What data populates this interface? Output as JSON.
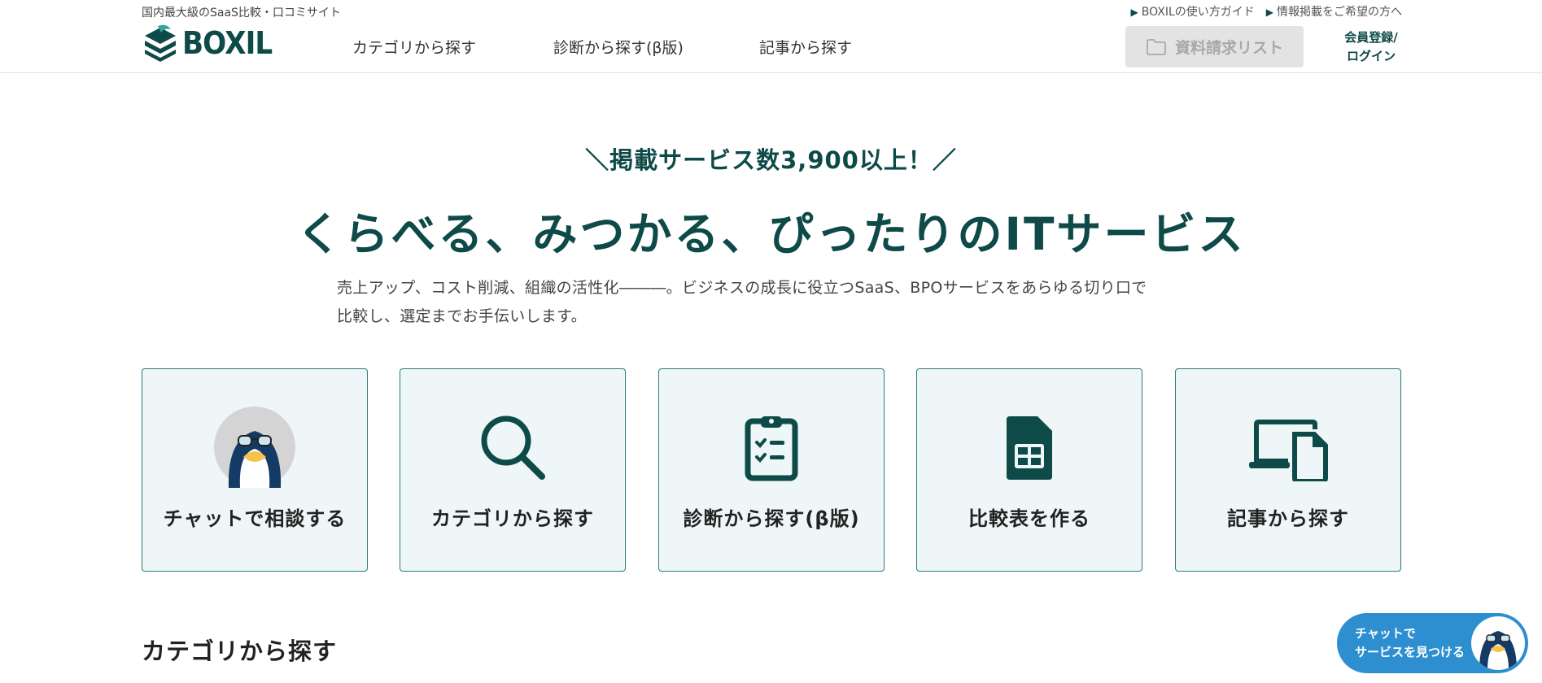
{
  "header": {
    "tagline": "国内最大級のSaaS比較・口コミサイト",
    "logo_text": "BOXIL",
    "nav": [
      "カテゴリから探す",
      "診断から探す(β版)",
      "記事から探す"
    ],
    "top_links": [
      "BOXILの使い方ガイド",
      "情報掲載をご希望の方へ"
    ],
    "request_list_label": "資料請求リスト",
    "login_line1": "会員登録/",
    "login_line2": "ログイン"
  },
  "hero": {
    "badge": "＼掲載サービス数3,900以上！／",
    "headline": "くらべる、みつかる、ぴったりのITサービス",
    "lead_line1": "売上アップ、コスト削減、組織の活性化―――。ビジネスの成長に役立つSaaS、BPOサービスをあらゆる切り口で",
    "lead_line2": "比較し、選定までお手伝いします。"
  },
  "cards": [
    {
      "label": "チャットで相談する",
      "icon": "penguin-avatar-icon"
    },
    {
      "label": "カテゴリから探す",
      "icon": "search-icon"
    },
    {
      "label": "診断から探す(β版)",
      "icon": "clipboard-checklist-icon"
    },
    {
      "label": "比較表を作る",
      "icon": "spreadsheet-file-icon"
    },
    {
      "label": "記事から探す",
      "icon": "devices-icon"
    }
  ],
  "section": {
    "title": "カテゴリから探す"
  },
  "chat_fab": {
    "line1": "チャットで",
    "line2": "サービスを見つける"
  },
  "colors": {
    "brand": "#0e4a48",
    "card_bg": "#eef6f7",
    "card_border": "#2a7b78",
    "highlight": "#f6ec9d",
    "chat_blue": "#2e8fd0"
  }
}
